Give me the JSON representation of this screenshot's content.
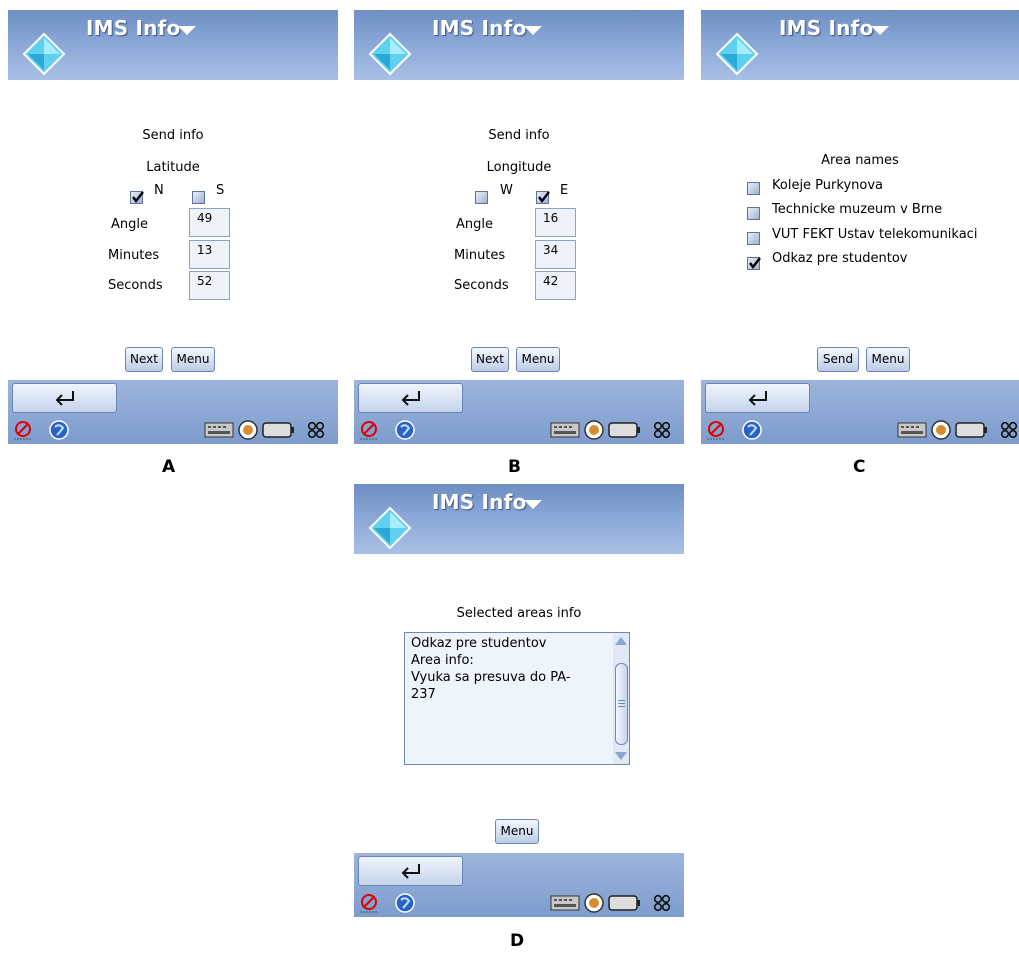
{
  "app": {
    "title": "IMS Info"
  },
  "colors": {
    "titlebar": "#88a6d6",
    "bottombar": "#8aa8d6",
    "accent": "#3f6fc0"
  },
  "screens": {
    "A": {
      "caption": "A",
      "heading": "Send info",
      "subheading": "Latitude",
      "options": [
        {
          "label": "N",
          "checked": true
        },
        {
          "label": "S",
          "checked": false
        }
      ],
      "rows": [
        {
          "label": "Angle",
          "value": "49"
        },
        {
          "label": "Minutes",
          "value": "13"
        },
        {
          "label": "Seconds",
          "value": "52"
        }
      ],
      "buttons": {
        "primary": "Next",
        "menu": "Menu"
      }
    },
    "B": {
      "caption": "B",
      "heading": "Send info",
      "subheading": "Longitude",
      "options": [
        {
          "label": "W",
          "checked": false
        },
        {
          "label": "E",
          "checked": true
        }
      ],
      "rows": [
        {
          "label": "Angle",
          "value": "16"
        },
        {
          "label": "Minutes",
          "value": "34"
        },
        {
          "label": "Seconds",
          "value": "42"
        }
      ],
      "buttons": {
        "primary": "Next",
        "menu": "Menu"
      }
    },
    "C": {
      "caption": "C",
      "heading": "Area names",
      "areas": [
        {
          "label": "Koleje Purkynova",
          "checked": false
        },
        {
          "label": "Technicke muzeum v Brne",
          "checked": false
        },
        {
          "label": "VUT FEKT Ustav telekomunikaci",
          "checked": false
        },
        {
          "label": "Odkaz pre studentov",
          "checked": true
        }
      ],
      "buttons": {
        "primary": "Send",
        "menu": "Menu"
      }
    },
    "D": {
      "caption": "D",
      "heading": "Selected areas info",
      "info_text": "Odkaz pre studentov\nArea info:\nVyuka sa presuva do PA-\n237",
      "buttons": {
        "menu": "Menu"
      }
    }
  },
  "statusbar": {
    "icons": [
      "no-signal-icon",
      "globe-icon",
      "keyboard-icon",
      "speaker-icon",
      "battery-icon",
      "apps-icon"
    ],
    "back_icon": "return-arrow-icon"
  }
}
